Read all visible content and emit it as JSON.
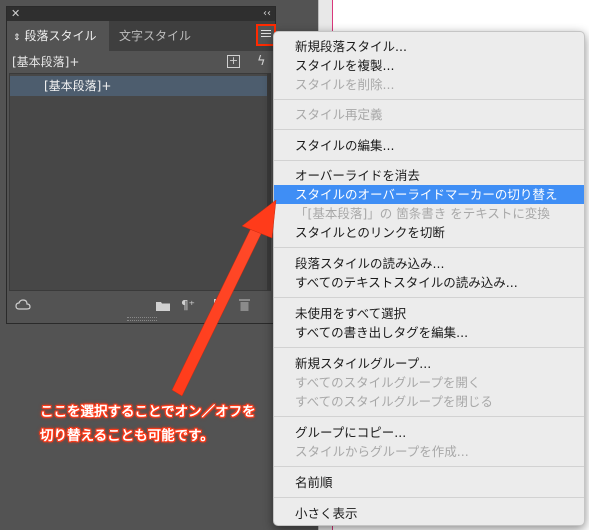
{
  "panel": {
    "close_glyph": "✕",
    "collapse_glyph": "‹‹",
    "tabs": [
      {
        "label": "段落スタイル",
        "active": true
      },
      {
        "label": "文字スタイル",
        "active": false
      }
    ],
    "tab_sort_glyph": "⇕",
    "default_style_label": "[基本段落]+",
    "list_items": [
      "[基本段落]+"
    ],
    "icons": {
      "new_style_group": "folder-icon",
      "clear_overrides": "paragraph-override-icon",
      "new_style": "new-style-icon",
      "delete": "trash-icon",
      "cloud": "cloud-library-icon",
      "bolt": "quick-apply-icon",
      "menu": "panel-menu-icon"
    }
  },
  "menu": {
    "groups": [
      [
        {
          "label": "新規段落スタイル...",
          "disabled": false
        },
        {
          "label": "スタイルを複製...",
          "disabled": false
        },
        {
          "label": "スタイルを削除...",
          "disabled": true
        }
      ],
      [
        {
          "label": "スタイル再定義",
          "disabled": true
        }
      ],
      [
        {
          "label": "スタイルの編集...",
          "disabled": false
        }
      ],
      [
        {
          "label": "オーバーライドを消去",
          "disabled": false
        },
        {
          "label": "スタイルのオーバーライドマーカーの切り替え",
          "disabled": false,
          "highlight": true
        },
        {
          "label": "「[基本段落]」の 箇条書き をテキストに変換",
          "disabled": true
        },
        {
          "label": "スタイルとのリンクを切断",
          "disabled": false
        }
      ],
      [
        {
          "label": "段落スタイルの読み込み...",
          "disabled": false
        },
        {
          "label": "すべてのテキストスタイルの読み込み...",
          "disabled": false
        }
      ],
      [
        {
          "label": "未使用をすべて選択",
          "disabled": false
        },
        {
          "label": "すべての書き出しタグを編集...",
          "disabled": false
        }
      ],
      [
        {
          "label": "新規スタイルグループ...",
          "disabled": false
        },
        {
          "label": "すべてのスタイルグループを開く",
          "disabled": true
        },
        {
          "label": "すべてのスタイルグループを閉じる",
          "disabled": true
        }
      ],
      [
        {
          "label": "グループにコピー...",
          "disabled": false
        },
        {
          "label": "スタイルからグループを作成...",
          "disabled": true
        }
      ],
      [
        {
          "label": "名前順",
          "disabled": false
        }
      ],
      [
        {
          "label": "小さく表示",
          "disabled": false
        }
      ]
    ]
  },
  "annotation": {
    "line1": "ここを選択することでオン／オフを",
    "line2": "切り替えることも可能です。",
    "color": "#ff3b1a"
  },
  "colors": {
    "highlight": "#3f8ef5",
    "callout_box": "#ff2a00",
    "selected_row": "#4d5d6e"
  }
}
